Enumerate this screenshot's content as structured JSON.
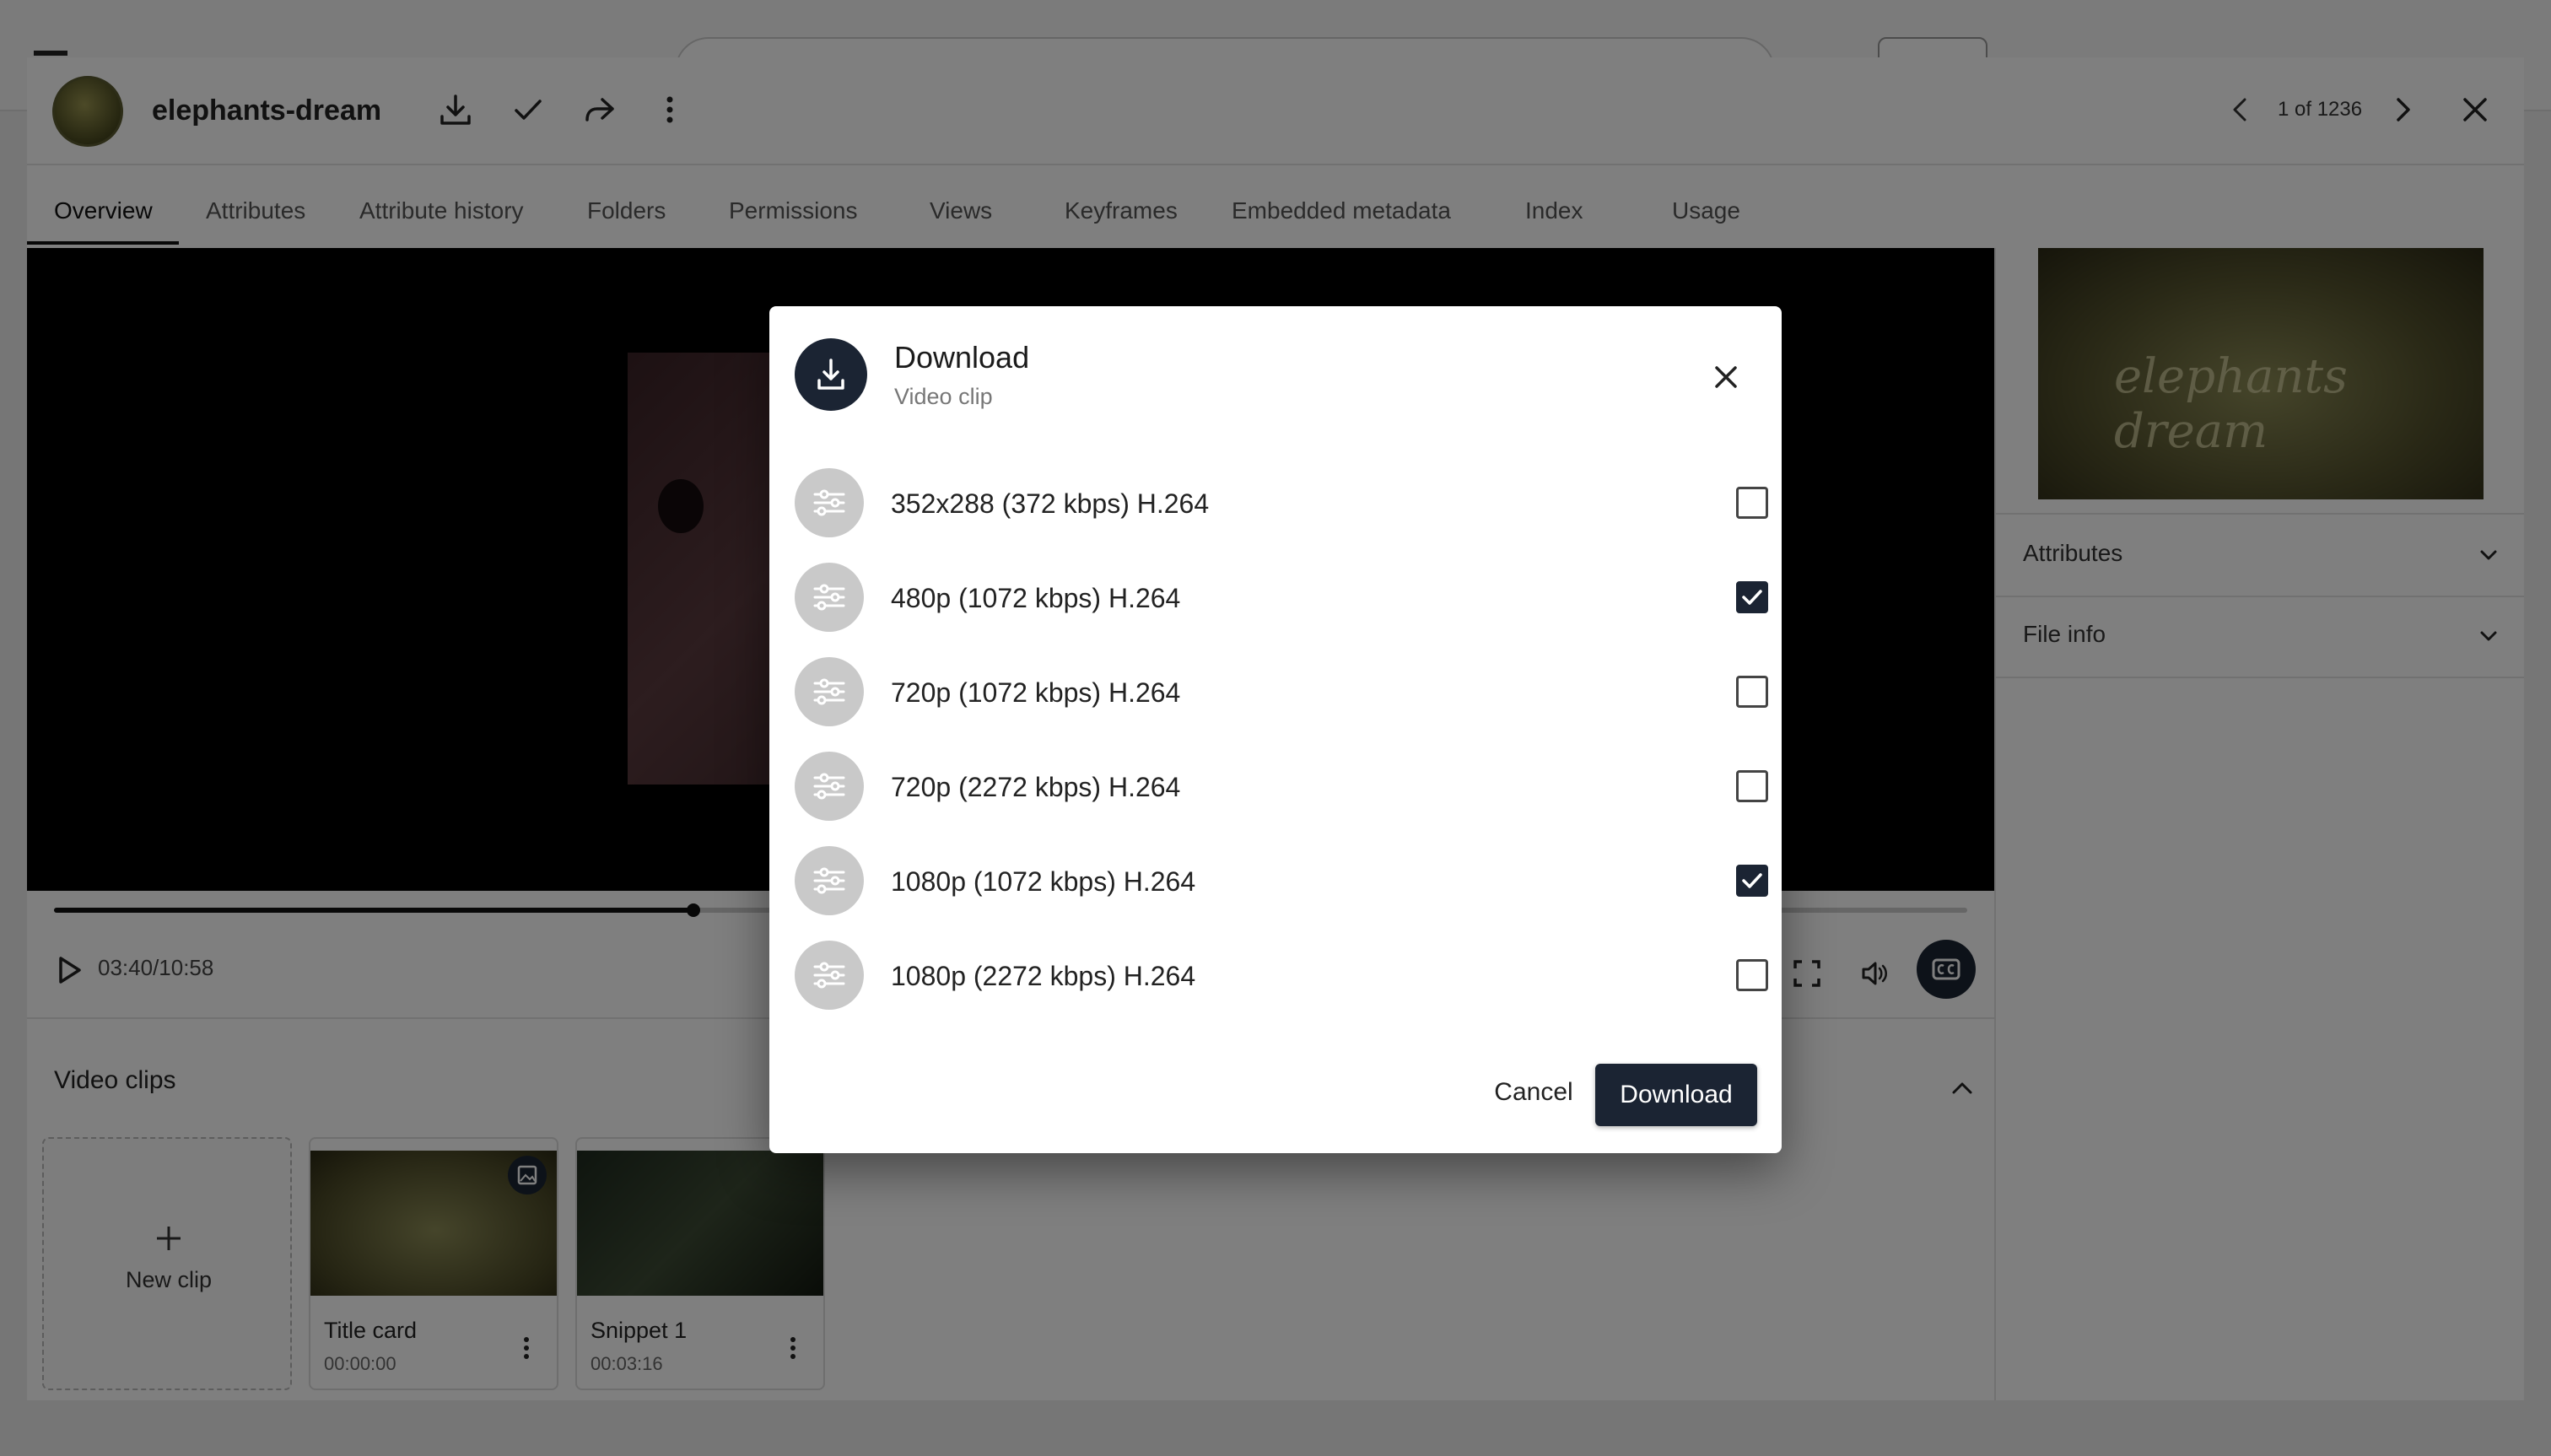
{
  "asset": {
    "title": "elephants-dream",
    "counter": "1 of 1236"
  },
  "tabs": [
    {
      "label": "Overview",
      "active": true
    },
    {
      "label": "Attributes"
    },
    {
      "label": "Attribute history"
    },
    {
      "label": "Folders"
    },
    {
      "label": "Permissions"
    },
    {
      "label": "Views"
    },
    {
      "label": "Keyframes"
    },
    {
      "label": "Embedded metadata"
    },
    {
      "label": "Index"
    },
    {
      "label": "Usage"
    }
  ],
  "player": {
    "timecode": "03:40/10:58",
    "progress_fraction": 0.335
  },
  "sidebar": {
    "thumb_text": "elephants dream",
    "sections": [
      {
        "label": "Attributes"
      },
      {
        "label": "File info"
      }
    ]
  },
  "clips": {
    "title": "Video clips",
    "new_clip_label": "New clip",
    "items": [
      {
        "label": "Title card",
        "time": "00:00:00"
      },
      {
        "label": "Snippet 1",
        "time": "00:03:16"
      }
    ]
  },
  "dialog": {
    "title": "Download",
    "subtitle": "Video clip",
    "options": [
      {
        "label": "352x288 (372 kbps) H.264",
        "checked": false
      },
      {
        "label": "480p (1072 kbps) H.264",
        "checked": true
      },
      {
        "label": "720p (1072 kbps) H.264",
        "checked": false
      },
      {
        "label": "720p (2272 kbps) H.264",
        "checked": false
      },
      {
        "label": "1080p (1072 kbps) H.264",
        "checked": true
      },
      {
        "label": "1080p (2272 kbps) H.264",
        "checked": false
      }
    ],
    "cancel_label": "Cancel",
    "download_label": "Download"
  },
  "colors": {
    "accent": "#1b2433",
    "overlay": "rgba(0,0,0,0.5)"
  }
}
